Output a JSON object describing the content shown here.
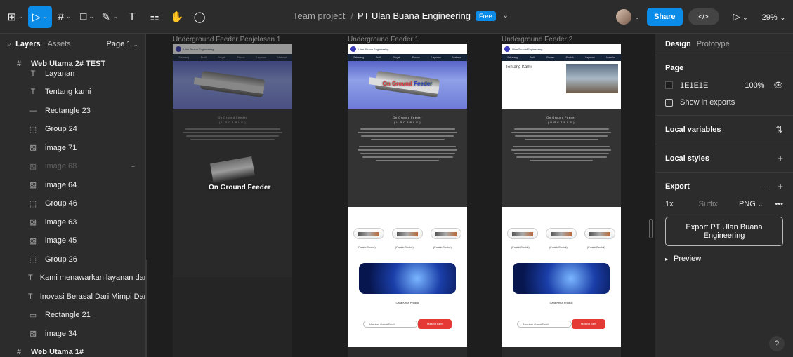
{
  "toolbar": {
    "tools": [
      {
        "name": "main-menu-icon",
        "glyph": "⊞"
      },
      {
        "name": "move-tool-icon",
        "glyph": "▷"
      },
      {
        "name": "frame-tool-icon",
        "glyph": "#"
      },
      {
        "name": "shape-tool-icon",
        "glyph": "□"
      },
      {
        "name": "pen-tool-icon",
        "glyph": "✎"
      },
      {
        "name": "text-tool-icon",
        "glyph": "T"
      },
      {
        "name": "resources-icon",
        "glyph": "⚏"
      },
      {
        "name": "hand-tool-icon",
        "glyph": "✋"
      },
      {
        "name": "comment-tool-icon",
        "glyph": "◯"
      }
    ],
    "project": "Team project",
    "file": "PT Ulan Buana Engineering",
    "plan_badge": "Free",
    "share_label": "Share",
    "code_label": "</>",
    "present_glyph": "▷",
    "zoom": "29%"
  },
  "layers_panel": {
    "tab_layers": "Layers",
    "tab_assets": "Assets",
    "page_selector": "Page 1",
    "root_frame": "Web Utama 2# TEST",
    "items": [
      {
        "label": "Layanan",
        "icon": "T",
        "dim": false
      },
      {
        "label": "Tentang kami",
        "icon": "T",
        "dim": false
      },
      {
        "label": "Rectangle 23",
        "icon": "—",
        "dim": false
      },
      {
        "label": "Group 24",
        "icon": "⬚",
        "dim": false
      },
      {
        "label": "image 71",
        "icon": "▨",
        "dim": false
      },
      {
        "label": "image 68",
        "icon": "▨",
        "dim": true
      },
      {
        "label": "image 64",
        "icon": "▨",
        "dim": false
      },
      {
        "label": "Group 46",
        "icon": "⬚",
        "dim": false
      },
      {
        "label": "image 63",
        "icon": "▨",
        "dim": false
      },
      {
        "label": "image 45",
        "icon": "▨",
        "dim": false
      },
      {
        "label": "Group 26",
        "icon": "⬚",
        "dim": false
      },
      {
        "label": "Kami menawarkan layanan dan...",
        "icon": "T",
        "dim": false
      },
      {
        "label": "Inovasi Berasal Dari Mimpi Dan...",
        "icon": "T",
        "dim": false
      },
      {
        "label": "Rectangle 21",
        "icon": "▭",
        "dim": false
      },
      {
        "label": "image 34",
        "icon": "▨",
        "dim": false
      }
    ],
    "next_frame": "Web Utama 1#"
  },
  "canvas": {
    "frames": [
      {
        "label": "Underground Feeder Penjelasan 1"
      },
      {
        "label": "Underground Feeder 1"
      },
      {
        "label": "Underground Feeder 2"
      }
    ],
    "company": "Ulan Buana Engineering",
    "nav": [
      "Sekarang",
      "Profil",
      "Proyek",
      "Produk",
      "Layanan",
      "Material"
    ],
    "hero_text_a": "On Ground",
    "hero_text_b": "Feeder",
    "section_title": "On Ground Feeder",
    "section_sub": "( U P  C A B L E )",
    "overlay_title": "On Ground Feeder",
    "products": [
      "(Contoh Produk)",
      "(Contoh Produk)",
      "(Contoh Produk)"
    ],
    "cara": "Cara Kerja Produk",
    "email_placeholder": "Masukan Alamat Email",
    "cta": "Hubungi Kami",
    "tentang": "Tentang Kami"
  },
  "design_panel": {
    "tab_design": "Design",
    "tab_prototype": "Prototype",
    "page_title": "Page",
    "bg_hex": "1E1E1E",
    "bg_opacity": "100%",
    "show_exports": "Show in exports",
    "local_variables": "Local variables",
    "local_styles": "Local styles",
    "export_title": "Export",
    "export_scale": "1x",
    "export_suffix": "Suffix",
    "export_format": "PNG",
    "export_button": "Export PT Ulan Buana Engineering",
    "preview": "Preview",
    "help": "?"
  }
}
